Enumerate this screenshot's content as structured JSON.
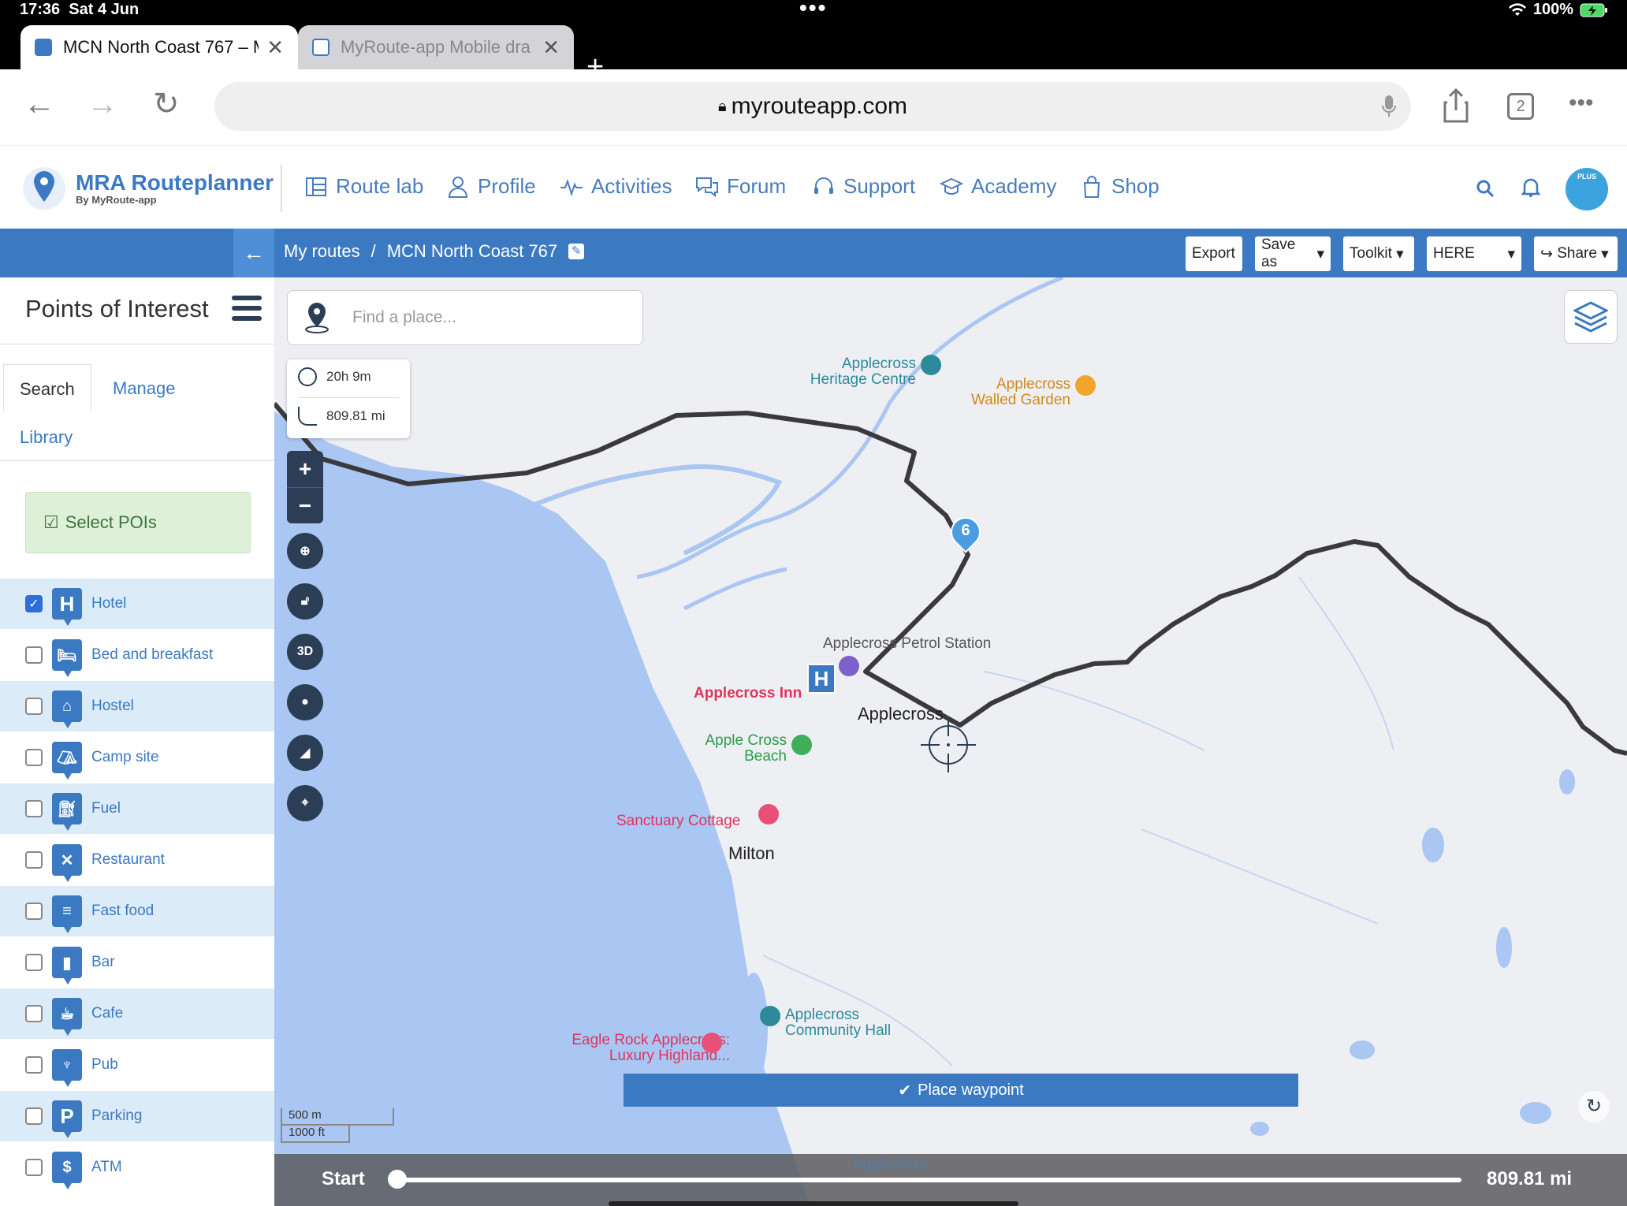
{
  "status": {
    "time": "17:36",
    "date": "Sat 4 Jun",
    "battery": "100%"
  },
  "browser": {
    "tabs": [
      {
        "title": "MCN North Coast 767 – M",
        "active": true
      },
      {
        "title": "MyRoute-app Mobile dra",
        "active": false
      }
    ],
    "url": "myrouteapp.com",
    "tab_count": "2"
  },
  "app": {
    "logo_title": "MRA Routeplanner",
    "logo_sub": "By MyRoute-app",
    "nav": [
      "Route lab",
      "Profile",
      "Activities",
      "Forum",
      "Support",
      "Academy",
      "Shop"
    ],
    "avatar_text": "PLUS"
  },
  "routebar": {
    "crumb_root": "My routes",
    "crumb_sep": "/",
    "crumb_current": "MCN North Coast 767",
    "buttons": {
      "export": "Export",
      "save_as": "Save as",
      "toolkit": "Toolkit",
      "provider": "HERE",
      "share": "Share"
    }
  },
  "sidebar": {
    "title": "Points of Interest",
    "tabs": {
      "search": "Search",
      "manage": "Manage",
      "library": "Library"
    },
    "select_pois": "Select POIs",
    "pois": [
      {
        "label": "Hotel",
        "checked": true,
        "icon": "H"
      },
      {
        "label": "Bed and breakfast",
        "checked": false,
        "icon": "bed"
      },
      {
        "label": "Hostel",
        "checked": false,
        "icon": "hostel"
      },
      {
        "label": "Camp site",
        "checked": false,
        "icon": "tent"
      },
      {
        "label": "Fuel",
        "checked": false,
        "icon": "fuel"
      },
      {
        "label": "Restaurant",
        "checked": false,
        "icon": "cutlery"
      },
      {
        "label": "Fast food",
        "checked": false,
        "icon": "fastfood"
      },
      {
        "label": "Bar",
        "checked": false,
        "icon": "beer"
      },
      {
        "label": "Cafe",
        "checked": false,
        "icon": "cup"
      },
      {
        "label": "Pub",
        "checked": false,
        "icon": "pub"
      },
      {
        "label": "Parking",
        "checked": false,
        "icon": "P"
      },
      {
        "label": "ATM",
        "checked": false,
        "icon": "atm"
      }
    ]
  },
  "map": {
    "search_placeholder": "Find a place...",
    "duration": "20h 9m",
    "distance": "809.81 mi",
    "labels": {
      "heritage": "Applecross\nHeritage Centre",
      "walled": "Applecross\nWalled Garden",
      "petrol": "Applecross Petrol Station",
      "inn": "Applecross Inn",
      "town": "Applecross",
      "beach": "Apple Cross\nBeach",
      "sanctuary": "Sanctuary Cottage",
      "milton": "Milton",
      "hall": "Applecross\nCommunity Hall",
      "eagle": "Eagle Rock Applecross:\nLuxury Highland...",
      "bottom": "Applecross"
    },
    "waypoint_number": "6",
    "place_waypoint": "Place waypoint",
    "scale_m": "500 m",
    "scale_ft": "1000 ft",
    "controls": {
      "zoom_in": "+",
      "zoom_out": "−",
      "three_d": "3D"
    },
    "slider": {
      "start": "Start",
      "end": "809.81 mi",
      "position": 0
    }
  },
  "colors": {
    "brand_blue": "#3b7ac2",
    "water": "#aac6f2",
    "route": "#3a3a3c"
  }
}
